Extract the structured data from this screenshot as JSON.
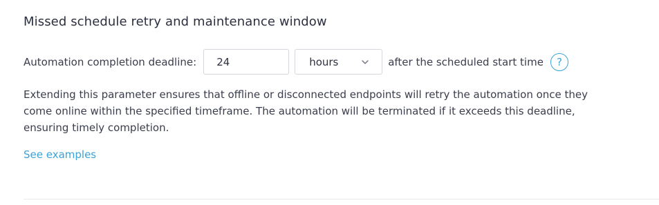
{
  "section": {
    "title": "Missed schedule retry and maintenance window"
  },
  "deadline": {
    "label": "Automation completion deadline:",
    "value": "24",
    "unit_selected": "hours",
    "suffix": "after the scheduled start time",
    "help_icon": "question-circle-icon",
    "help_symbol": "?"
  },
  "description": {
    "lines": [
      "Extending this parameter ensures that offline or disconnected endpoints will retry the automation once they",
      "come online within the specified timeframe. The automation will be terminated if it exceeds this deadline,",
      "ensuring timely completion."
    ]
  },
  "link": {
    "see_examples": "See examples"
  },
  "colors": {
    "accent": "#3aa3d8",
    "text": "#3a3d4c",
    "heading": "#2b2f3f",
    "border": "#d4d7de"
  }
}
